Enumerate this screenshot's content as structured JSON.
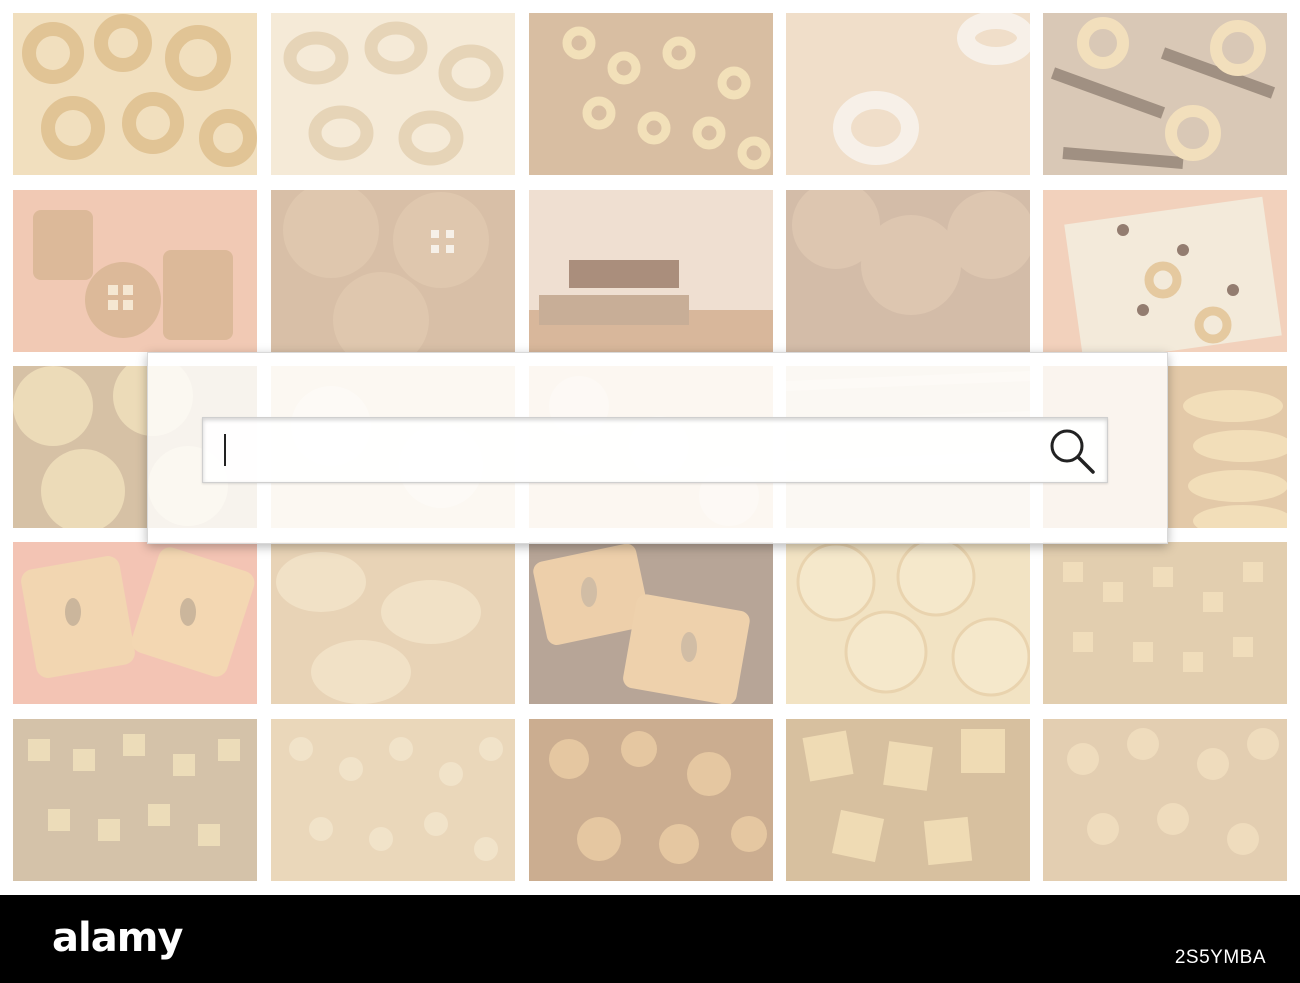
{
  "search": {
    "placeholder": ""
  },
  "footer": {
    "brand": "alamy",
    "image_id": "2S5YMBA"
  },
  "colors": {
    "footer_bg": "#000000",
    "panel_bg": "#ffffff",
    "tile_tint": "#e3c49b"
  },
  "icons": {
    "search": "magnifier-icon"
  }
}
